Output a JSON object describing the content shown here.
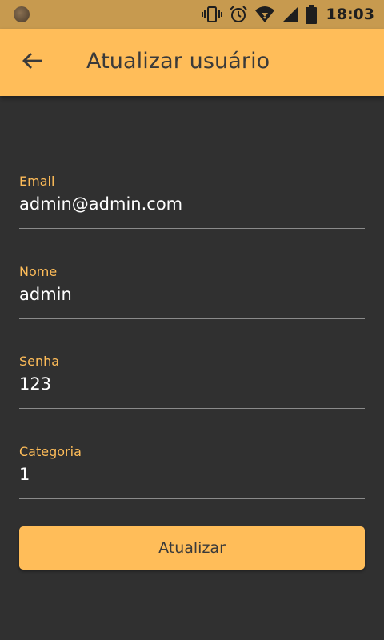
{
  "status_bar": {
    "time": "18:03",
    "icons": [
      "vibrate-icon",
      "alarm-icon",
      "wifi-icon",
      "signal-icon",
      "battery-icon"
    ]
  },
  "app_bar": {
    "title": "Atualizar usuário",
    "back_icon": "arrow-back-icon"
  },
  "form": {
    "fields": [
      {
        "label": "Email",
        "value": "admin@admin.com"
      },
      {
        "label": "Nome",
        "value": "admin"
      },
      {
        "label": "Senha",
        "value": "123"
      },
      {
        "label": "Categoria",
        "value": "1"
      }
    ],
    "submit_label": "Atualizar"
  },
  "colors": {
    "accent": "#ffbd59",
    "status_bar": "#c79a4f",
    "background": "#303030",
    "text_primary": "#ffffff",
    "text_dark": "#3a3a3a",
    "underline": "#8a8a8a"
  }
}
